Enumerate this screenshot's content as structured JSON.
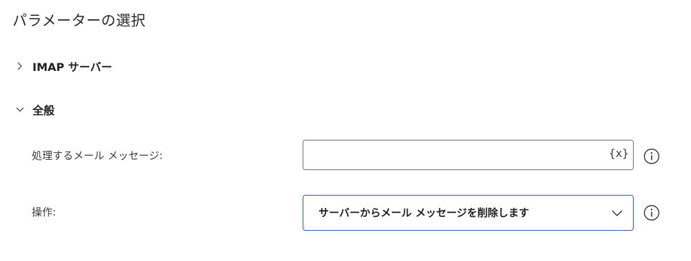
{
  "page": {
    "title": "パラメーターの選択"
  },
  "sections": {
    "imap": {
      "label": "IMAP サーバー",
      "expanded": false,
      "icon": "chevron-right-icon"
    },
    "general": {
      "label": "全般",
      "expanded": true,
      "icon": "chevron-down-icon"
    }
  },
  "fields": {
    "messages": {
      "label": "処理するメール メッセージ:",
      "value": "",
      "variable_button": "{x}",
      "info_icon": "info-icon"
    },
    "operation": {
      "label": "操作:",
      "selected": "サーバーからメール メッセージを削除します",
      "dropdown_icon": "chevron-down-icon",
      "info_icon": "info-icon"
    }
  },
  "colors": {
    "focus_border": "#1f5fa8",
    "input_border": "#6e6e6e",
    "text": "#1f1f1f"
  }
}
